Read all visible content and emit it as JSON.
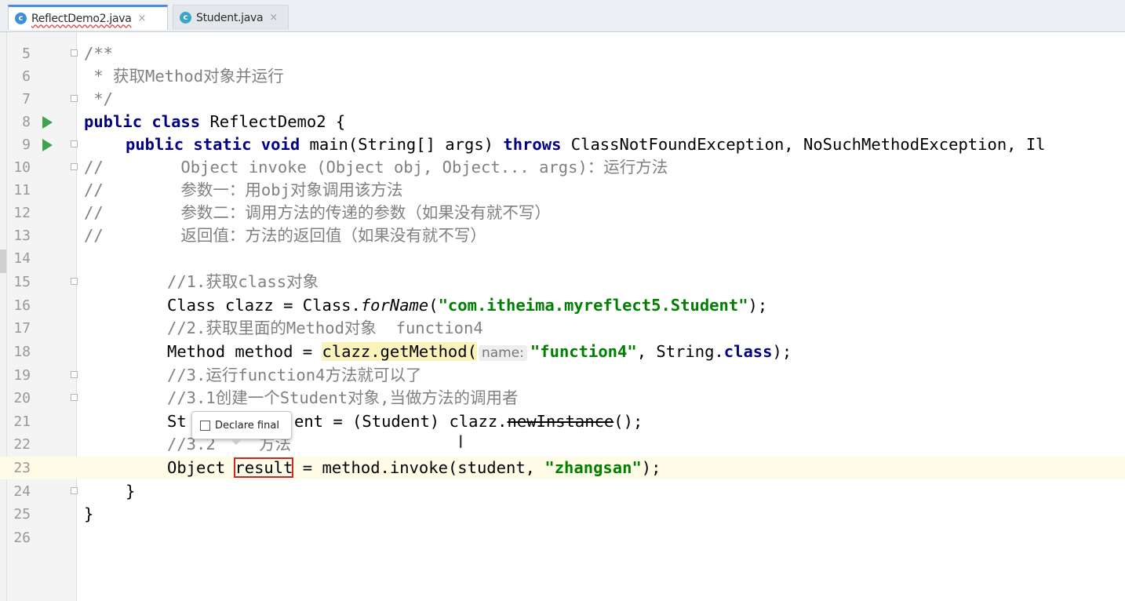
{
  "tabs": [
    {
      "label": "ReflectDemo2.java",
      "icon": "class-file-icon",
      "active": true
    },
    {
      "label": "Student.java",
      "icon": "class-file-icon",
      "active": false
    }
  ],
  "tab_close_glyph": "×",
  "gutter": {
    "line_numbers": [
      "5",
      "6",
      "7",
      "8",
      "9",
      "10",
      "11",
      "12",
      "13",
      "14",
      "15",
      "16",
      "17",
      "18",
      "19",
      "20",
      "21",
      "22",
      "23",
      "24",
      "25",
      "26"
    ],
    "current_line": "23"
  },
  "code": {
    "l5": "/**",
    "l6": " * 获取Method对象并运行",
    "l7": " */",
    "l8_kw": "public class",
    "l8_rest": " ReflectDemo2 {",
    "l9_kw1": "public static void",
    "l9_mid": " main(String[] args) ",
    "l9_kw2": "throws",
    "l9_rest": " ClassNotFoundException, NoSuchMethodException, Il",
    "l10": "//        Object invoke (Object obj, Object... args)：运行方法",
    "l11": "//        参数一：用obj对象调用该方法",
    "l12": "//        参数二：调用方法的传递的参数（如果没有就不写）",
    "l13": "//        返回值：方法的返回值（如果没有就不写）",
    "l15": "//1.获取class对象",
    "l16_a": "Class clazz = Class.",
    "l16_b": "forName",
    "l16_c": "(",
    "l16_str": "\"com.itheima.myreflect5.Student\"",
    "l16_d": ");",
    "l17": "//2.获取里面的Method对象  function4",
    "l18_a": "Method method = ",
    "l18_hl": "clazz.getMethod(",
    "l18_hint": "name:",
    "l18_str": "\"function4\"",
    "l18_b": ", String.",
    "l18_kw": "class",
    "l18_c": ");",
    "l19": "//3.运行function4方法就可以了",
    "l20": "//3.1创建一个Student对象,当做方法的调用者",
    "l21_a": "St",
    "l21_b": "ent = (Student) clazz.",
    "l21_strike": "newInstance",
    "l21_c": "();",
    "l22_a": "//3.2",
    "l22_b": "方法",
    "l23_a": "Object ",
    "l23_boxed": "result",
    "l23_b": " = method.invoke(student, ",
    "l23_str": "\"zhangsan\"",
    "l23_c": ");",
    "l24": "}",
    "l25": "}"
  },
  "popup": {
    "label": "Declare final",
    "checked": false
  },
  "colors": {
    "keyword": "#000080",
    "string": "#008000",
    "comment": "#808080",
    "current_line": "#fefbe6",
    "run_icon": "#3fa34d"
  }
}
